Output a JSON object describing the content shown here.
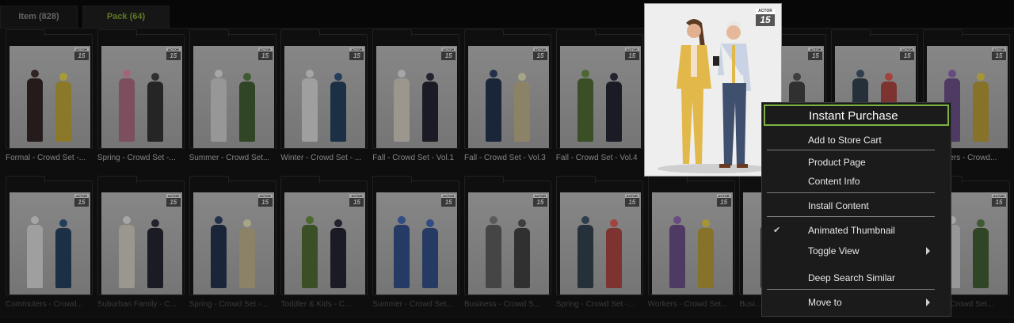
{
  "tabs": [
    {
      "label": "Item (828)"
    },
    {
      "label": "Pack (64)"
    }
  ],
  "badge": {
    "type": "ACTOR",
    "number": "15"
  },
  "cards_row1": [
    {
      "title": "Formal - Crowd Set -..."
    },
    {
      "title": "Spring - Crowd Set -..."
    },
    {
      "title": "Summer - Crowd Set..."
    },
    {
      "title": "Winter - Crowd Set - ..."
    },
    {
      "title": "Fall - Crowd Set - Vol.1"
    },
    {
      "title": "Fall - Crowd Set - Vol.3"
    },
    {
      "title": "Fall - Crowd Set - Vol.4"
    },
    {
      "title": ""
    },
    {
      "title": ""
    },
    {
      "title": ""
    },
    {
      "title": "...mmuters - Crowd..."
    }
  ],
  "cards_row2": [
    {
      "title": "Commuters - Crowd..."
    },
    {
      "title": "Suburban Family - C..."
    },
    {
      "title": "Spring - Crowd Set -..."
    },
    {
      "title": "Toddler & Kids - C..."
    },
    {
      "title": "Summer - Crowd Set..."
    },
    {
      "title": "Business - Crowd S..."
    },
    {
      "title": "Spring - Crowd Set -..."
    },
    {
      "title": "Workers - Crowd Set..."
    },
    {
      "title": "Busi..."
    },
    {
      "title": ""
    },
    {
      "title": "...mer - Crowd Set..."
    }
  ],
  "context_menu": {
    "instant_purchase": "Instant Purchase",
    "add_to_cart": "Add to Store Cart",
    "product_page": "Product Page",
    "content_info": "Content Info",
    "install_content": "Install Content",
    "animated_thumbnail": "Animated Thumbnail",
    "animated_thumbnail_checked": "✔",
    "toggle_view": "Toggle View",
    "deep_search": "Deep Search Similar",
    "move_to": "Move to"
  },
  "colors": {
    "accent": "#7cb342",
    "active_tab_text": "#8fb83a",
    "background": "#0c0c0c",
    "menu_background": "#1b1b1b"
  }
}
